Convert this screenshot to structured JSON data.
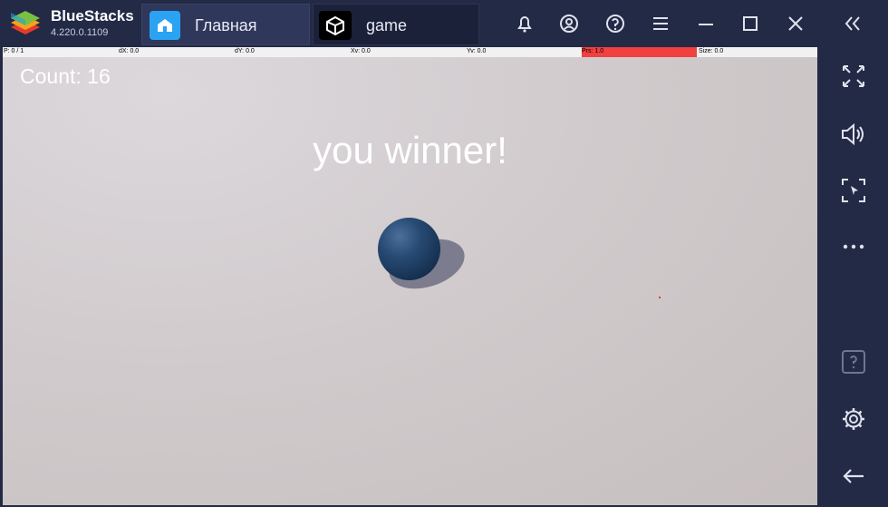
{
  "app": {
    "name": "BlueStacks",
    "version": "4.220.0.1109"
  },
  "tabs": [
    {
      "label": "Главная",
      "icon": "home-icon"
    },
    {
      "label": "game",
      "icon": "unity-icon"
    }
  ],
  "titlebar_buttons": [
    "bell-icon",
    "account-icon",
    "help-icon",
    "menu-icon",
    "minimize-icon",
    "maximize-icon",
    "close-icon",
    "collapse-sidebar-icon"
  ],
  "sidebar_buttons": [
    "fullscreen-icon",
    "volume-icon",
    "screenshot-icon",
    "more-icon",
    "help-icon",
    "settings-icon",
    "back-icon"
  ],
  "hud": {
    "p": "P: 0 / 1",
    "dx": "dX: 0.0",
    "dy": "dY: 0.0",
    "xv": "Xv: 0.0",
    "yv": "Yv: 0.0",
    "prs": "Prs: 1.0",
    "size": "Size: 0.0"
  },
  "game": {
    "count": "Count: 16",
    "message": "you winner!"
  },
  "colors": {
    "chrome": "#232a45",
    "tab_active": "#2f375a",
    "accent_blue": "#2aa3f2",
    "prs_bar": "#f23f3f"
  }
}
